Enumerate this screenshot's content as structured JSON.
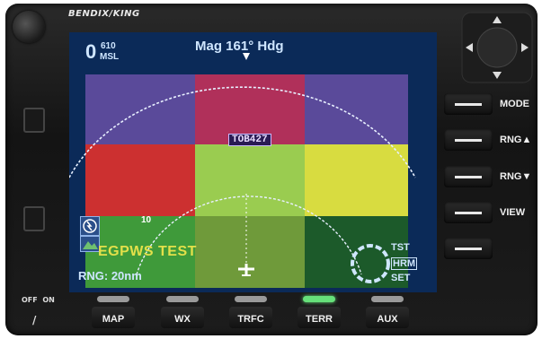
{
  "brand": "BENDIX/KING",
  "power": {
    "off_label": "OFF",
    "on_label": "ON",
    "mark": "/"
  },
  "display": {
    "altitude_value": "0",
    "altitude_sup": "610",
    "altitude_unit": "MSL",
    "heading_text": "Mag 161° Hdg",
    "waypoint": "TOB427",
    "inner_ring_label": "10",
    "status_message": "EGPWS TEST",
    "range_text": "RNG: 20nm",
    "mode_tst": "TST",
    "mode_hrm": "HRM",
    "mode_set": "SET",
    "terrain_colors": {
      "purple": "#5a4a9a",
      "magenta": "#b0305a",
      "red": "#cc3030",
      "lightgreen": "#9acc50",
      "yellow": "#d8dc40",
      "green": "#3f9a3a",
      "darkgreen": "#1c5a2a"
    }
  },
  "side_keys": [
    {
      "label": "MODE"
    },
    {
      "label": "RNG▲"
    },
    {
      "label": "RNG▼"
    },
    {
      "label": "VIEW"
    },
    {
      "label": ""
    }
  ],
  "bottom_keys": [
    {
      "label": "MAP",
      "active": false
    },
    {
      "label": "WX",
      "active": false
    },
    {
      "label": "TRFC",
      "active": false
    },
    {
      "label": "TERR",
      "active": true
    },
    {
      "label": "AUX",
      "active": false
    }
  ]
}
